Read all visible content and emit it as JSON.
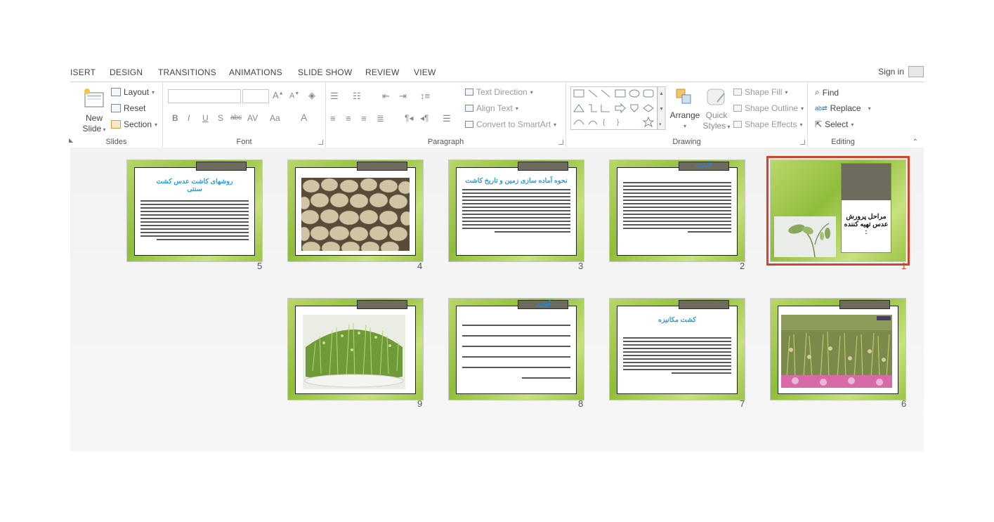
{
  "tabs": [
    "ISERT",
    "DESIGN",
    "TRANSITIONS",
    "ANIMATIONS",
    "SLIDE SHOW",
    "REVIEW",
    "VIEW"
  ],
  "signin": "Sign in",
  "ribbon": {
    "slides": {
      "new_slide_line1": "New",
      "new_slide_line2": "Slide",
      "layout": "Layout",
      "reset": "Reset",
      "section": "Section",
      "label": "Slides"
    },
    "font": {
      "label": "Font"
    },
    "paragraph": {
      "text_direction": "Text Direction",
      "align_text": "Align Text",
      "convert_smartart": "Convert to SmartArt",
      "label": "Paragraph"
    },
    "drawing": {
      "arrange": "Arrange",
      "quick_styles_line1": "Quick",
      "quick_styles_line2": "Styles",
      "shape_fill": "Shape Fill",
      "shape_outline": "Shape Outline",
      "shape_effects": "Shape Effects",
      "label": "Drawing"
    },
    "editing": {
      "find": "Find",
      "replace": "Replace",
      "select": "Select",
      "label": "Editing"
    }
  },
  "slides": [
    {
      "num": "1",
      "title": "مراحل پرورش عدس تهیه کننده :",
      "selected": true
    },
    {
      "num": "2",
      "tag": "کاشت"
    },
    {
      "num": "3",
      "title": "نحوه آماده سازی زمین و تاریخ کاشت"
    },
    {
      "num": "4"
    },
    {
      "num": "5",
      "title": "روشهای کاشت عدس کشت سنتی"
    },
    {
      "num": "6"
    },
    {
      "num": "7",
      "title": "کشت مکانیزه"
    },
    {
      "num": "8",
      "tag": "آبیاری"
    },
    {
      "num": "9"
    }
  ],
  "colors": {
    "selection": "#d0442a",
    "slide_green": "#9cc447",
    "title_blue": "#2a9ad8",
    "tag_bar": "#6f6a5e"
  }
}
